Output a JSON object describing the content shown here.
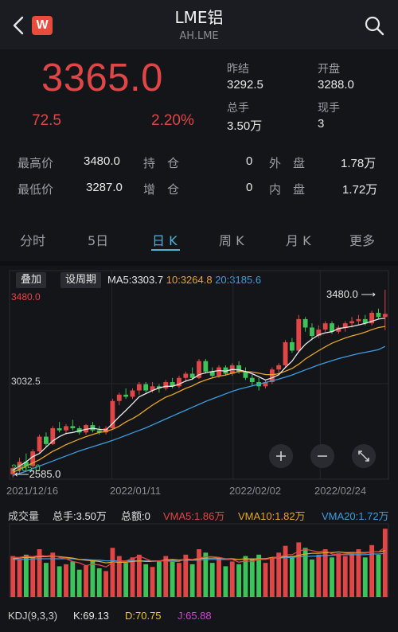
{
  "header": {
    "title": "LME铝",
    "subtitle": "AH.LME",
    "logo_text": "W"
  },
  "quote": {
    "price": "3365.0",
    "change": "72.5",
    "change_pct": "2.20%",
    "prev_close_label": "昨结",
    "prev_close": "3292.5",
    "open_label": "开盘",
    "open": "3288.0",
    "total_vol_label": "总手",
    "total_vol": "3.50万",
    "cur_vol_label": "现手",
    "cur_vol": "3",
    "high_label": "最高价",
    "high": "3480.0",
    "low_label": "最低价",
    "low": "3287.0",
    "oi_label": "持　仓",
    "oi": "0",
    "oi_chg_label": "增　仓",
    "oi_chg": "0",
    "outer_label": "外　盘",
    "outer": "1.78万",
    "inner_label": "内　盘",
    "inner": "1.72万"
  },
  "tabs": [
    "分时",
    "5日",
    "日 K",
    "周 K",
    "月 K",
    "更多"
  ],
  "active_tab": "日 K",
  "toolbar": {
    "overlay": "叠加",
    "period": "设周期"
  },
  "ma": {
    "ma5_label": "MA5:",
    "ma5": "3303.7",
    "ma10_label": "10:",
    "ma10": "3264.8",
    "ma20_label": "20:",
    "ma20": "3185.6"
  },
  "chart_labels": {
    "top_price": "3480.0",
    "mid_price": "3032.5",
    "low_price": "2585.0",
    "max_marker": "3480.0",
    "min_marker": "2585.0"
  },
  "dates": [
    "2021/12/16",
    "2022/01/11",
    "2022/02/02",
    "2022/02/24"
  ],
  "volume": {
    "title": "成交量",
    "total": "总手:3.50万",
    "amount": "总额:0",
    "vma5": "VMA5:1.86万",
    "vma10": "VMA10:1.82万",
    "vma20": "VMA20:1.72万"
  },
  "kdj": {
    "label": "KDJ(9,3,3)",
    "k": "K:69.13",
    "d": "D:70.75",
    "j": "J:65.88"
  },
  "colors": {
    "up": "#e04646",
    "down": "#3cc35a",
    "ma5": "#e8e8e8",
    "ma10": "#e8a628",
    "ma20": "#3b9de0",
    "accent": "#4fb3d9"
  },
  "chart_data": {
    "type": "candlestick",
    "price_range": [
      2585.0,
      3480.0
    ],
    "candles": [
      {
        "o": 2600,
        "h": 2640,
        "l": 2585,
        "c": 2630
      },
      {
        "o": 2625,
        "h": 2680,
        "l": 2600,
        "c": 2660
      },
      {
        "o": 2660,
        "h": 2700,
        "l": 2620,
        "c": 2640
      },
      {
        "o": 2640,
        "h": 2720,
        "l": 2630,
        "c": 2710
      },
      {
        "o": 2710,
        "h": 2790,
        "l": 2700,
        "c": 2780
      },
      {
        "o": 2780,
        "h": 2800,
        "l": 2730,
        "c": 2745
      },
      {
        "o": 2745,
        "h": 2830,
        "l": 2740,
        "c": 2820
      },
      {
        "o": 2820,
        "h": 2850,
        "l": 2800,
        "c": 2810
      },
      {
        "o": 2810,
        "h": 2840,
        "l": 2790,
        "c": 2830
      },
      {
        "o": 2830,
        "h": 2860,
        "l": 2810,
        "c": 2820
      },
      {
        "o": 2820,
        "h": 2830,
        "l": 2790,
        "c": 2800
      },
      {
        "o": 2800,
        "h": 2840,
        "l": 2790,
        "c": 2835
      },
      {
        "o": 2835,
        "h": 2850,
        "l": 2800,
        "c": 2810
      },
      {
        "o": 2810,
        "h": 2830,
        "l": 2790,
        "c": 2800
      },
      {
        "o": 2800,
        "h": 2830,
        "l": 2790,
        "c": 2820
      },
      {
        "o": 2820,
        "h": 2960,
        "l": 2815,
        "c": 2950
      },
      {
        "o": 2950,
        "h": 2990,
        "l": 2930,
        "c": 2980
      },
      {
        "o": 2980,
        "h": 3010,
        "l": 2960,
        "c": 2970
      },
      {
        "o": 2970,
        "h": 3010,
        "l": 2960,
        "c": 3000
      },
      {
        "o": 3000,
        "h": 3040,
        "l": 2980,
        "c": 3030
      },
      {
        "o": 3030,
        "h": 3040,
        "l": 2990,
        "c": 3000
      },
      {
        "o": 3000,
        "h": 3040,
        "l": 2990,
        "c": 3020
      },
      {
        "o": 3020,
        "h": 3030,
        "l": 2990,
        "c": 3010
      },
      {
        "o": 3010,
        "h": 3050,
        "l": 3000,
        "c": 3040
      },
      {
        "o": 3040,
        "h": 3060,
        "l": 3010,
        "c": 3020
      },
      {
        "o": 3020,
        "h": 3070,
        "l": 3010,
        "c": 3060
      },
      {
        "o": 3060,
        "h": 3090,
        "l": 3040,
        "c": 3080
      },
      {
        "o": 3080,
        "h": 3110,
        "l": 3050,
        "c": 3060
      },
      {
        "o": 3060,
        "h": 3150,
        "l": 3055,
        "c": 3140
      },
      {
        "o": 3140,
        "h": 3150,
        "l": 3080,
        "c": 3090
      },
      {
        "o": 3090,
        "h": 3110,
        "l": 3060,
        "c": 3070
      },
      {
        "o": 3070,
        "h": 3120,
        "l": 3060,
        "c": 3110
      },
      {
        "o": 3110,
        "h": 3120,
        "l": 3070,
        "c": 3080
      },
      {
        "o": 3080,
        "h": 3130,
        "l": 3070,
        "c": 3120
      },
      {
        "o": 3120,
        "h": 3140,
        "l": 3080,
        "c": 3090
      },
      {
        "o": 3090,
        "h": 3110,
        "l": 3050,
        "c": 3060
      },
      {
        "o": 3060,
        "h": 3080,
        "l": 3020,
        "c": 3040
      },
      {
        "o": 3040,
        "h": 3060,
        "l": 3000,
        "c": 3020
      },
      {
        "o": 3020,
        "h": 3050,
        "l": 3010,
        "c": 3040
      },
      {
        "o": 3040,
        "h": 3110,
        "l": 3030,
        "c": 3100
      },
      {
        "o": 3100,
        "h": 3130,
        "l": 3080,
        "c": 3120
      },
      {
        "o": 3120,
        "h": 3240,
        "l": 3110,
        "c": 3230
      },
      {
        "o": 3230,
        "h": 3250,
        "l": 3180,
        "c": 3190
      },
      {
        "o": 3190,
        "h": 3360,
        "l": 3180,
        "c": 3340
      },
      {
        "o": 3340,
        "h": 3350,
        "l": 3280,
        "c": 3300
      },
      {
        "o": 3300,
        "h": 3320,
        "l": 3240,
        "c": 3260
      },
      {
        "o": 3260,
        "h": 3310,
        "l": 3250,
        "c": 3290
      },
      {
        "o": 3290,
        "h": 3330,
        "l": 3280,
        "c": 3320
      },
      {
        "o": 3320,
        "h": 3330,
        "l": 3270,
        "c": 3280
      },
      {
        "o": 3280,
        "h": 3310,
        "l": 3270,
        "c": 3300
      },
      {
        "o": 3300,
        "h": 3330,
        "l": 3280,
        "c": 3320
      },
      {
        "o": 3320,
        "h": 3350,
        "l": 3300,
        "c": 3330
      },
      {
        "o": 3330,
        "h": 3360,
        "l": 3310,
        "c": 3340
      },
      {
        "o": 3340,
        "h": 3360,
        "l": 3310,
        "c": 3320
      },
      {
        "o": 3320,
        "h": 3380,
        "l": 3310,
        "c": 3370
      },
      {
        "o": 3370,
        "h": 3390,
        "l": 3340,
        "c": 3350
      },
      {
        "o": 3350,
        "h": 3480,
        "l": 3287,
        "c": 3365
      }
    ],
    "ma5": [
      2620,
      2640,
      2660,
      2685,
      2700,
      2730,
      2760,
      2780,
      2795,
      2800,
      2808,
      2815,
      2820,
      2815,
      2812,
      2842,
      2875,
      2905,
      2937,
      2970,
      2985,
      3000,
      3012,
      3020,
      3020,
      3030,
      3045,
      3055,
      3075,
      3085,
      3090,
      3095,
      3092,
      3100,
      3098,
      3090,
      3080,
      3065,
      3050,
      3060,
      3075,
      3110,
      3140,
      3185,
      3220,
      3245,
      3265,
      3275,
      3280,
      3295,
      3300,
      3305,
      3312,
      3320,
      3330,
      3340,
      3345
    ],
    "ma10": [
      2610,
      2625,
      2640,
      2655,
      2670,
      2690,
      2710,
      2725,
      2742,
      2755,
      2768,
      2780,
      2790,
      2800,
      2805,
      2815,
      2830,
      2850,
      2866,
      2885,
      2908,
      2930,
      2950,
      2968,
      2980,
      2995,
      3010,
      3022,
      3038,
      3050,
      3060,
      3068,
      3074,
      3082,
      3090,
      3090,
      3088,
      3082,
      3076,
      3075,
      3080,
      3092,
      3105,
      3125,
      3150,
      3170,
      3190,
      3208,
      3225,
      3238,
      3250,
      3260,
      3268,
      3278,
      3290,
      3300,
      3305
    ],
    "ma20": [
      2595,
      2605,
      2615,
      2628,
      2640,
      2652,
      2664,
      2676,
      2688,
      2700,
      2712,
      2722,
      2732,
      2742,
      2752,
      2762,
      2774,
      2786,
      2798,
      2810,
      2822,
      2836,
      2850,
      2864,
      2878,
      2892,
      2906,
      2920,
      2934,
      2948,
      2960,
      2972,
      2984,
      2996,
      3006,
      3014,
      3022,
      3030,
      3038,
      3046,
      3054,
      3064,
      3074,
      3086,
      3098,
      3110,
      3122,
      3132,
      3142,
      3152,
      3160,
      3168,
      3176,
      3182,
      3188,
      3195,
      3210
    ],
    "volumes": [
      60,
      55,
      62,
      58,
      70,
      50,
      65,
      45,
      48,
      52,
      40,
      46,
      55,
      42,
      38,
      72,
      60,
      50,
      58,
      62,
      48,
      44,
      52,
      60,
      55,
      50,
      62,
      48,
      70,
      65,
      50,
      58,
      45,
      52,
      48,
      60,
      55,
      62,
      50,
      58,
      65,
      75,
      60,
      80,
      72,
      55,
      62,
      70,
      58,
      64,
      60,
      66,
      70,
      58,
      76,
      62,
      100
    ],
    "volume_ma5": [
      58,
      58,
      60,
      59,
      61,
      60,
      61,
      58,
      56,
      52,
      50,
      46,
      48,
      47,
      44,
      50,
      53,
      53,
      56,
      60,
      56,
      52,
      53,
      53,
      52,
      52,
      56,
      55,
      57,
      59,
      59,
      58,
      56,
      55,
      51,
      53,
      52,
      55,
      55,
      57,
      58,
      62,
      62,
      67,
      70,
      68,
      66,
      68,
      63,
      62,
      63,
      64,
      64,
      64,
      66,
      66,
      73
    ],
    "volume_ma10": [
      56,
      57,
      58,
      58,
      59,
      59,
      60,
      59,
      58,
      57,
      55,
      54,
      53,
      52,
      50,
      51,
      51,
      51,
      52,
      53,
      52,
      52,
      53,
      54,
      55,
      54,
      55,
      54,
      56,
      57,
      57,
      57,
      56,
      56,
      55,
      56,
      55,
      56,
      56,
      58,
      58,
      59,
      59,
      61,
      63,
      64,
      64,
      65,
      65,
      66,
      65,
      65,
      65,
      65,
      66,
      66,
      68
    ],
    "volume_ma20": [
      55,
      55,
      55,
      56,
      56,
      56,
      56,
      56,
      56,
      56,
      55,
      55,
      54,
      54,
      53,
      53,
      53,
      53,
      53,
      53,
      53,
      53,
      53,
      53,
      53,
      54,
      54,
      54,
      54,
      55,
      55,
      55,
      55,
      55,
      55,
      56,
      56,
      56,
      56,
      57,
      57,
      58,
      58,
      59,
      59,
      60,
      60,
      61,
      61,
      62,
      62,
      62,
      62,
      62,
      63,
      63,
      64
    ]
  }
}
